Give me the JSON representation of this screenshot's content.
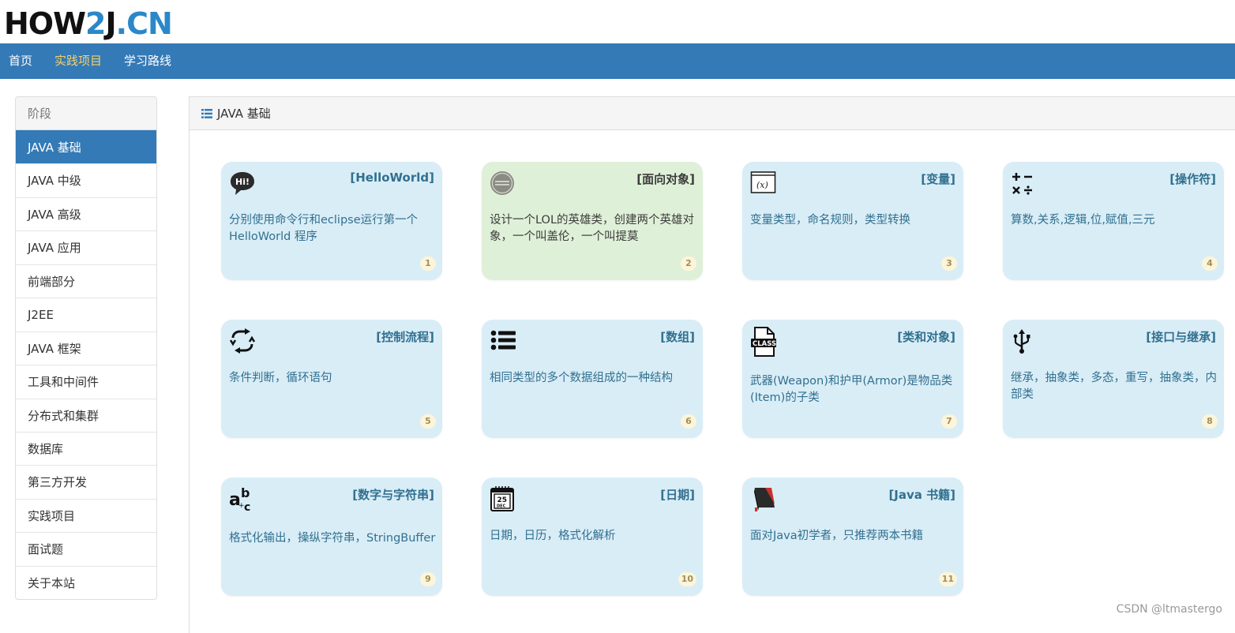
{
  "logo": {
    "part1": "HOW",
    "part2": "2",
    "part3": "J",
    "dot": ".",
    "part4": "CN"
  },
  "nav": {
    "items": [
      "首页",
      "实践项目",
      "学习路线"
    ],
    "active_index": 1
  },
  "sidebar": {
    "header": "阶段",
    "items": [
      "JAVA 基础",
      "JAVA 中级",
      "JAVA 高级",
      "JAVA 应用",
      "前端部分",
      "J2EE",
      "JAVA 框架",
      "工具和中间件",
      "分布式和集群",
      "数据库",
      "第三方开发",
      "实践项目",
      "面试题",
      "关于本站"
    ],
    "active_index": 0
  },
  "panel": {
    "title": "JAVA 基础",
    "title_icon": "list-icon"
  },
  "cards": [
    {
      "title": "[HelloWorld]",
      "desc": "分别使用命令行和eclipse运行第一个HelloWorld 程序",
      "num": "1",
      "icon": "hi-speech-bubble-icon",
      "color": "blue"
    },
    {
      "title": "[面向对象]",
      "desc": "设计一个LOL的英雄类，创建两个英雄对象，一个叫盖伦，一个叫提莫",
      "num": "2",
      "icon": "league-of-legends-icon",
      "color": "green"
    },
    {
      "title": "[变量]",
      "desc": "变量类型，命名规则，类型转换",
      "num": "3",
      "icon": "variable-x-icon",
      "color": "blue"
    },
    {
      "title": "[操作符]",
      "desc": "算数,关系,逻辑,位,赋值,三元",
      "num": "4",
      "icon": "calculator-operators-icon",
      "color": "blue"
    },
    {
      "title": "[控制流程]",
      "desc": "条件判断，循环语句",
      "num": "5",
      "icon": "loop-arrows-icon",
      "color": "blue"
    },
    {
      "title": "[数组]",
      "desc": "相同类型的多个数据组成的一种结构",
      "num": "6",
      "icon": "list-bullets-icon",
      "color": "blue"
    },
    {
      "title": "[类和对象]",
      "desc": "武器(Weapon)和护甲(Armor)是物品类(Item)的子类",
      "num": "7",
      "icon": "class-file-icon",
      "color": "blue"
    },
    {
      "title": "[接口与继承]",
      "desc": "继承，抽象类，多态，重写，抽象类，内部类",
      "num": "8",
      "icon": "usb-icon",
      "color": "blue"
    },
    {
      "title": "[数字与字符串]",
      "desc": "格式化输出，操纵字符串，StringBuffer",
      "num": "9",
      "icon": "abc-text-icon",
      "color": "blue"
    },
    {
      "title": "[日期]",
      "desc": "日期，日历，格式化解析",
      "num": "10",
      "icon": "calendar-icon",
      "color": "blue"
    },
    {
      "title": "[Java 书籍]",
      "desc": "面对Java初学者，只推荐两本书籍",
      "num": "11",
      "icon": "book-icon",
      "color": "blue"
    }
  ],
  "calendar_icon_text": {
    "day": "25",
    "month": "DEC"
  },
  "class_icon_text": "CLASS",
  "watermark": "CSDN @ltmastergo"
}
